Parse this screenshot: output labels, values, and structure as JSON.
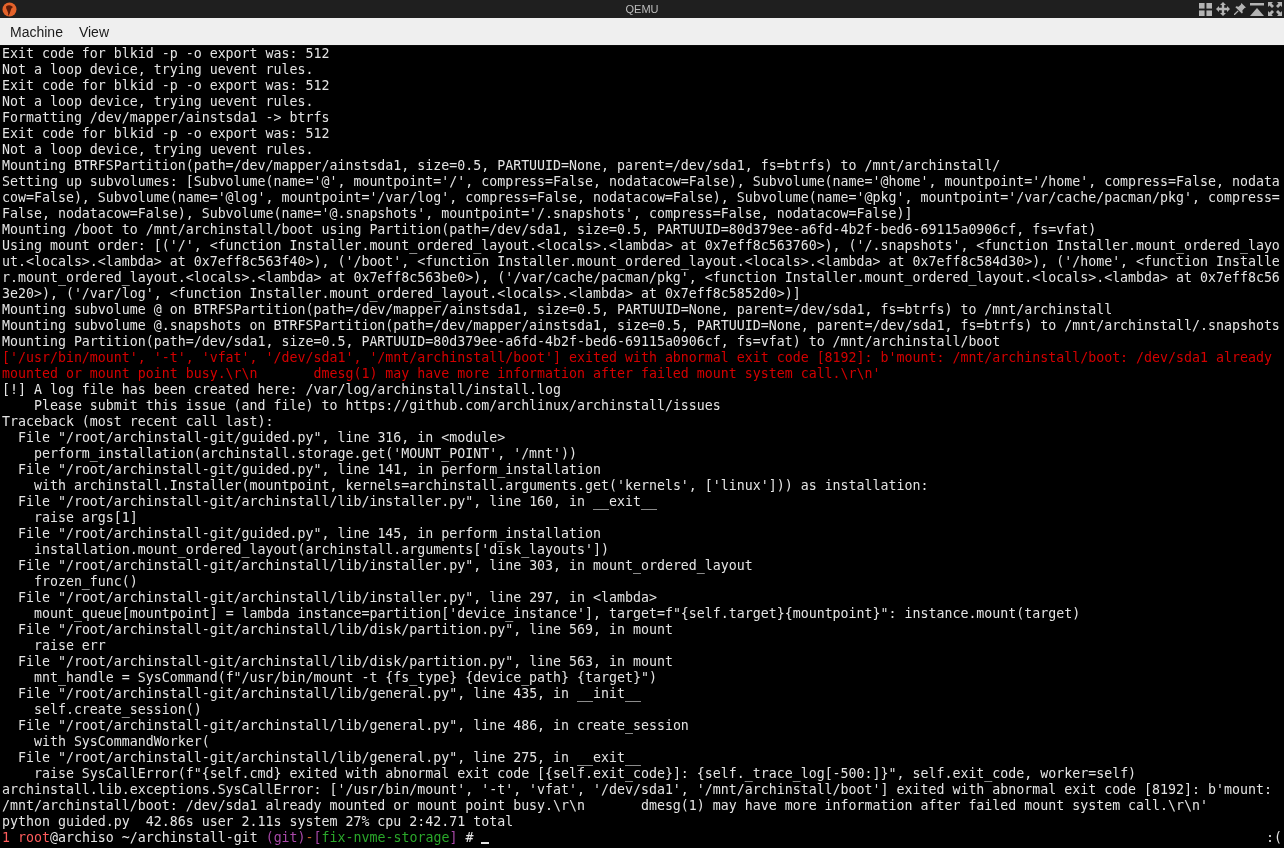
{
  "window": {
    "title": "QEMU"
  },
  "menu_bar": {
    "items": [
      "Machine",
      "View"
    ]
  },
  "terminal": {
    "lines": [
      {
        "text": "Exit code for blkid -p -o export was: 512",
        "kind": "output"
      },
      {
        "text": "Not a loop device, trying uevent rules.",
        "kind": "output"
      },
      {
        "text": "Exit code for blkid -p -o export was: 512",
        "kind": "output"
      },
      {
        "text": "Not a loop device, trying uevent rules.",
        "kind": "output"
      },
      {
        "text": "Formatting /dev/mapper/ainstsda1 -> btrfs",
        "kind": "output"
      },
      {
        "text": "Exit code for blkid -p -o export was: 512",
        "kind": "output"
      },
      {
        "text": "Not a loop device, trying uevent rules.",
        "kind": "output"
      },
      {
        "text": "Mounting BTRFSPartition(path=/dev/mapper/ainstsda1, size=0.5, PARTUUID=None, parent=/dev/sda1, fs=btrfs) to /mnt/archinstall/",
        "kind": "output"
      },
      {
        "text": "Setting up subvolumes: [Subvolume(name='@', mountpoint='/', compress=False, nodatacow=False), Subvolume(name='@home', mountpoint='/home', compress=False, nodata",
        "kind": "output"
      },
      {
        "text": "cow=False), Subvolume(name='@log', mountpoint='/var/log', compress=False, nodatacow=False), Subvolume(name='@pkg', mountpoint='/var/cache/pacman/pkg', compress=",
        "kind": "output"
      },
      {
        "text": "False, nodatacow=False), Subvolume(name='@.snapshots', mountpoint='/.snapshots', compress=False, nodatacow=False)]",
        "kind": "output"
      },
      {
        "text": "Mounting /boot to /mnt/archinstall/boot using Partition(path=/dev/sda1, size=0.5, PARTUUID=80d379ee-a6fd-4b2f-bed6-69115a0906cf, fs=vfat)",
        "kind": "output"
      },
      {
        "text": "Using mount order: [('/', <function Installer.mount_ordered_layout.<locals>.<lambda> at 0x7eff8c563760>), ('/.snapshots', <function Installer.mount_ordered_layo",
        "kind": "output"
      },
      {
        "text": "ut.<locals>.<lambda> at 0x7eff8c563f40>), ('/boot', <function Installer.mount_ordered_layout.<locals>.<lambda> at 0x7eff8c584d30>), ('/home', <function Installe",
        "kind": "output"
      },
      {
        "text": "r.mount_ordered_layout.<locals>.<lambda> at 0x7eff8c563be0>), ('/var/cache/pacman/pkg', <function Installer.mount_ordered_layout.<locals>.<lambda> at 0x7eff8c56",
        "kind": "output"
      },
      {
        "text": "3e20>), ('/var/log', <function Installer.mount_ordered_layout.<locals>.<lambda> at 0x7eff8c5852d0>)]",
        "kind": "output"
      },
      {
        "text": "Mounting subvolume @ on BTRFSPartition(path=/dev/mapper/ainstsda1, size=0.5, PARTUUID=None, parent=/dev/sda1, fs=btrfs) to /mnt/archinstall",
        "kind": "output"
      },
      {
        "text": "Mounting subvolume @.snapshots on BTRFSPartition(path=/dev/mapper/ainstsda1, size=0.5, PARTUUID=None, parent=/dev/sda1, fs=btrfs) to /mnt/archinstall/.snapshots",
        "kind": "output"
      },
      {
        "text": "Mounting Partition(path=/dev/sda1, size=0.5, PARTUUID=80d379ee-a6fd-4b2f-bed6-69115a0906cf, fs=vfat) to /mnt/archinstall/boot",
        "kind": "output"
      },
      {
        "text": "['/usr/bin/mount', '-t', 'vfat', '/dev/sda1', '/mnt/archinstall/boot'] exited with abnormal exit code [8192]: b'mount: /mnt/archinstall/boot: /dev/sda1 already",
        "kind": "error"
      },
      {
        "text": "mounted or mount point busy.\\r\\n       dmesg(1) may have more information after failed mount system call.\\r\\n'",
        "kind": "error"
      },
      {
        "text": "[!] A log file has been created here: /var/log/archinstall/install.log",
        "kind": "output"
      },
      {
        "text": "    Please submit this issue (and file) to https://github.com/archlinux/archinstall/issues",
        "kind": "output"
      },
      {
        "text": "Traceback (most recent call last):",
        "kind": "output"
      },
      {
        "text": "  File \"/root/archinstall-git/guided.py\", line 316, in <module>",
        "kind": "output"
      },
      {
        "text": "    perform_installation(archinstall.storage.get('MOUNT_POINT', '/mnt'))",
        "kind": "output"
      },
      {
        "text": "  File \"/root/archinstall-git/guided.py\", line 141, in perform_installation",
        "kind": "output"
      },
      {
        "text": "    with archinstall.Installer(mountpoint, kernels=archinstall.arguments.get('kernels', ['linux'])) as installation:",
        "kind": "output"
      },
      {
        "text": "  File \"/root/archinstall-git/archinstall/lib/installer.py\", line 160, in __exit__",
        "kind": "output"
      },
      {
        "text": "    raise args[1]",
        "kind": "output"
      },
      {
        "text": "  File \"/root/archinstall-git/guided.py\", line 145, in perform_installation",
        "kind": "output"
      },
      {
        "text": "    installation.mount_ordered_layout(archinstall.arguments['disk_layouts'])",
        "kind": "output"
      },
      {
        "text": "  File \"/root/archinstall-git/archinstall/lib/installer.py\", line 303, in mount_ordered_layout",
        "kind": "output"
      },
      {
        "text": "    frozen_func()",
        "kind": "output"
      },
      {
        "text": "  File \"/root/archinstall-git/archinstall/lib/installer.py\", line 297, in <lambda>",
        "kind": "output"
      },
      {
        "text": "    mount_queue[mountpoint] = lambda instance=partition['device_instance'], target=f\"{self.target}{mountpoint}\": instance.mount(target)",
        "kind": "output"
      },
      {
        "text": "  File \"/root/archinstall-git/archinstall/lib/disk/partition.py\", line 569, in mount",
        "kind": "output"
      },
      {
        "text": "    raise err",
        "kind": "output"
      },
      {
        "text": "  File \"/root/archinstall-git/archinstall/lib/disk/partition.py\", line 563, in mount",
        "kind": "output"
      },
      {
        "text": "    mnt_handle = SysCommand(f\"/usr/bin/mount -t {fs_type} {device_path} {target}\")",
        "kind": "output"
      },
      {
        "text": "  File \"/root/archinstall-git/archinstall/lib/general.py\", line 435, in __init__",
        "kind": "output"
      },
      {
        "text": "    self.create_session()",
        "kind": "output"
      },
      {
        "text": "  File \"/root/archinstall-git/archinstall/lib/general.py\", line 486, in create_session",
        "kind": "output"
      },
      {
        "text": "    with SysCommandWorker(",
        "kind": "output"
      },
      {
        "text": "  File \"/root/archinstall-git/archinstall/lib/general.py\", line 275, in __exit__",
        "kind": "output"
      },
      {
        "text": "    raise SysCallError(f\"{self.cmd} exited with abnormal exit code [{self.exit_code}]: {self._trace_log[-500:]}\", self.exit_code, worker=self)",
        "kind": "output"
      },
      {
        "text": "archinstall.lib.exceptions.SysCallError: ['/usr/bin/mount', '-t', 'vfat', '/dev/sda1', '/mnt/archinstall/boot'] exited with abnormal exit code [8192]: b'mount:",
        "kind": "output"
      },
      {
        "text": "/mnt/archinstall/boot: /dev/sda1 already mounted or mount point busy.\\r\\n       dmesg(1) may have more information after failed mount system call.\\r\\n'",
        "kind": "output"
      },
      {
        "text": "python guided.py  42.86s user 2.11s system 27% cpu 2:42.71 total",
        "kind": "output"
      }
    ],
    "prompt": {
      "words": [
        [
          {
            "text": "1",
            "color": "#ff5c5c"
          }
        ],
        [
          {
            "text": "root",
            "color": "#ff5c5c"
          },
          {
            "text": "@archiso",
            "color": "#e6e6e6"
          }
        ],
        [
          {
            "text": "~/archinstall-git",
            "color": "#e6e6e6"
          }
        ],
        [
          {
            "text": "(git)",
            "color": "#a848a8"
          },
          {
            "text": "-",
            "color": "#c8642a"
          },
          {
            "text": "[",
            "color": "#a848a8"
          },
          {
            "text": "fix-nvme-storage",
            "color": "#2aa82a"
          },
          {
            "text": "]",
            "color": "#a848a8"
          }
        ],
        [
          {
            "text": "#",
            "color": "#e6e6e6"
          }
        ]
      ],
      "cursor": true,
      "status": ":("
    }
  }
}
